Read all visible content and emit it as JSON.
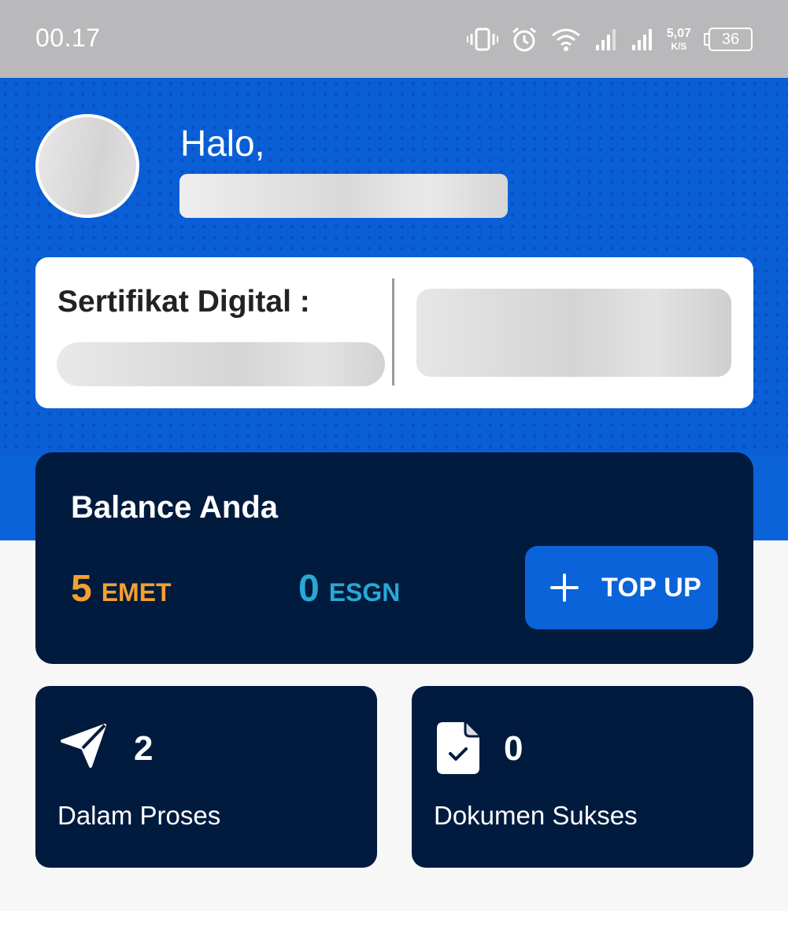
{
  "status_bar": {
    "time": "00.17",
    "net_speed_value": "5,07",
    "net_speed_unit": "K/S",
    "battery_level": "36",
    "icons": [
      "vibrate-icon",
      "alarm-icon",
      "wifi-icon",
      "signal-icon",
      "signal-icon",
      "battery-icon"
    ]
  },
  "header": {
    "greeting": "Halo,"
  },
  "certificate": {
    "title": "Sertifikat Digital :"
  },
  "balance": {
    "title": "Balance Anda",
    "emet_value": "5",
    "emet_unit": "EMET",
    "esgn_value": "0",
    "esgn_unit": "ESGN",
    "topup_label": "TOP UP"
  },
  "stats": {
    "in_process": {
      "value": "2",
      "label": "Dalam Proses",
      "icon": "send-icon"
    },
    "success": {
      "value": "0",
      "label": "Dokumen Sukses",
      "icon": "document-check-icon"
    }
  },
  "colors": {
    "primary_blue": "#0a63d8",
    "navy": "#001b3e",
    "emet_orange": "#f5a02e",
    "esgn_cyan": "#29a8d4"
  }
}
